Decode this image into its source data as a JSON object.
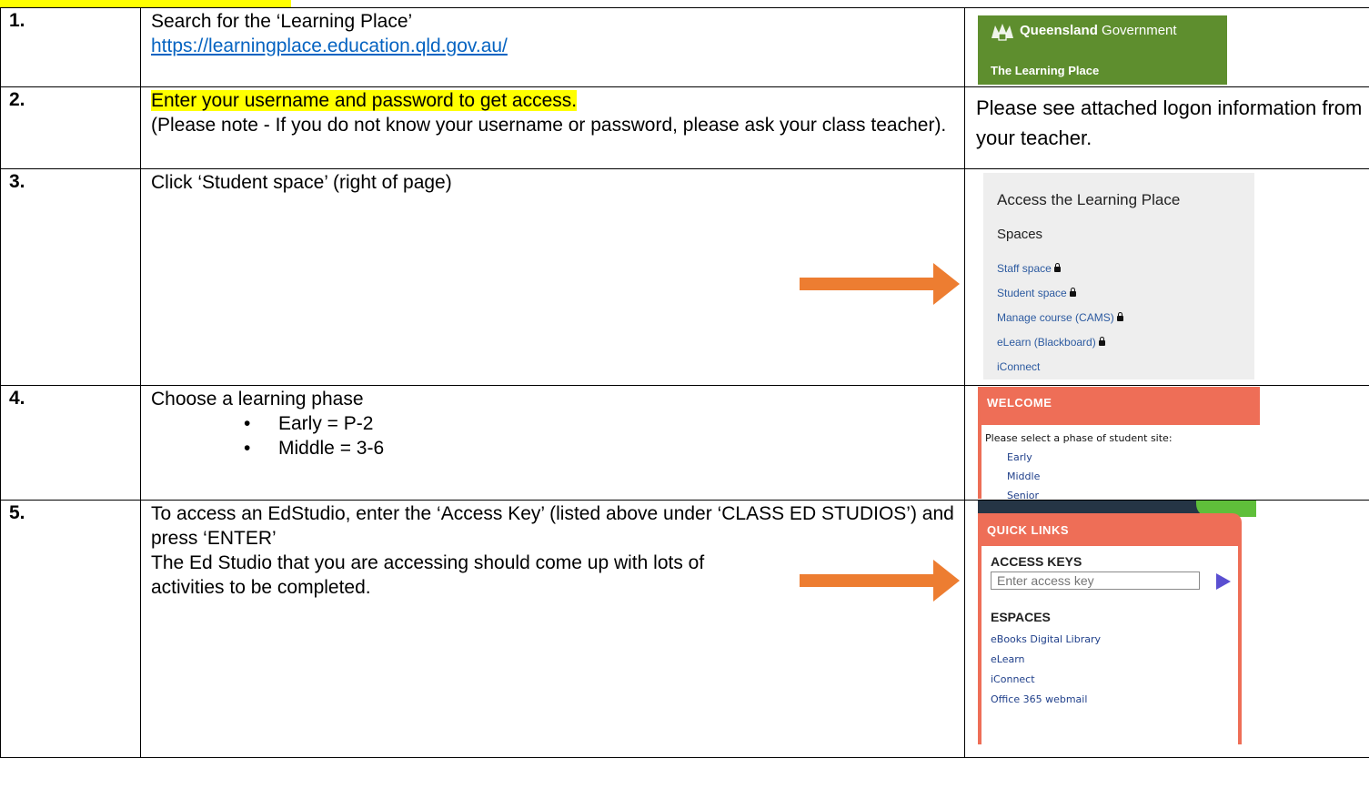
{
  "rows": [
    {
      "num": "1.",
      "text": "Search for the ‘Learning Place’",
      "link": "https://learningplace.education.qld.gov.au/",
      "banner": {
        "name_bold": "Queensland",
        "name_rest": " Government",
        "subtitle": "The Learning Place",
        "crest_icon": "queensland-crest-icon"
      }
    },
    {
      "num": "2.",
      "text_highlight": "Enter your username and password to get access.",
      "text_note": "(Please note - If you do not know your username or password, please ask your class teacher).",
      "side_text": "Please see attached logon information from your teacher."
    },
    {
      "num": "3.",
      "text": "Click ‘Student space’ (right of page)",
      "arrow_icon": "arrow-right-icon",
      "panel": {
        "title": "Access the Learning Place",
        "heading": "Spaces",
        "links": [
          "Staff space",
          "Student space",
          "Manage course (CAMS)",
          "eLearn (Blackboard)",
          "iConnect"
        ],
        "lock_icon": "lock-icon"
      }
    },
    {
      "num": "4.",
      "text": "Choose a learning phase",
      "bullets": [
        "Early = P-2",
        "Middle = 3-6"
      ],
      "panel": {
        "title": "WELCOME",
        "prompt": "Please select a phase of student site:",
        "links": [
          "Early",
          "Middle",
          "Senior"
        ]
      }
    },
    {
      "num": "5.",
      "text_line1": "To access an EdStudio, enter the ‘Access Key’ (listed above under ‘CLASS ED STUDIOS’) and press ‘ENTER’",
      "text_line2": "The Ed Studio that you are accessing should come up with lots of activities to be completed.",
      "arrow_icon": "arrow-right-icon",
      "panel": {
        "title": "QUICK LINKS",
        "keys_heading": "ACCESS KEYS",
        "input_placeholder": "Enter access key",
        "submit_icon": "play-arrow-icon",
        "espaces_heading": "ESPACES",
        "links": [
          "eBooks Digital Library",
          "eLearn",
          "iConnect",
          "Office 365 webmail"
        ]
      }
    }
  ],
  "colors": {
    "highlight": "#ffff00",
    "arrow": "#ed7d31",
    "link": "#0563c1",
    "qld_green": "#5e8e2e",
    "coral": "#ee6e57"
  }
}
